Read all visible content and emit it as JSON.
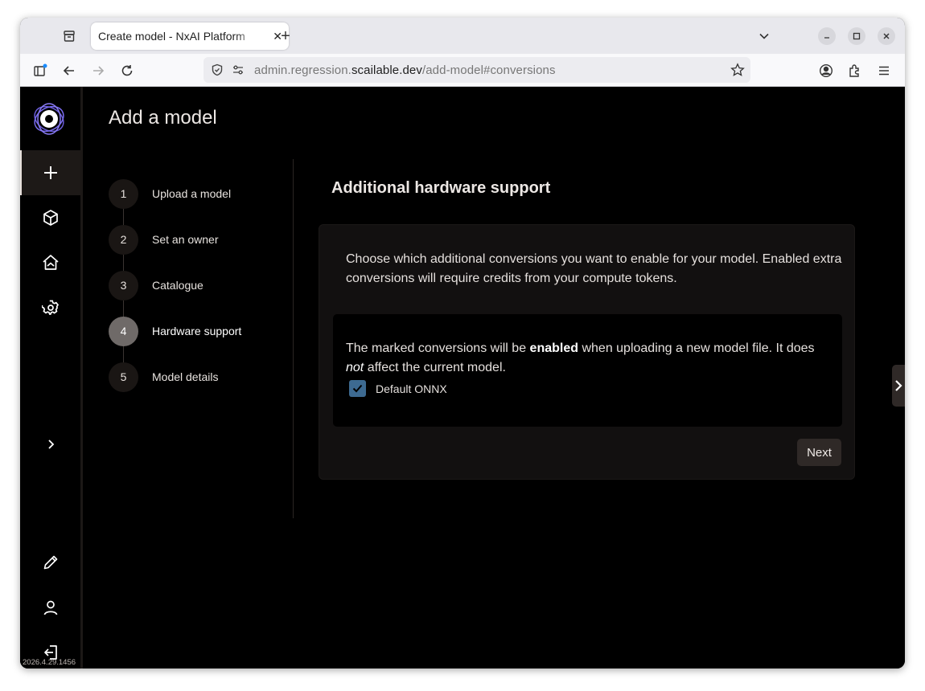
{
  "browser": {
    "tab_title": "Create model - NxAI Platform",
    "tab_close": "✕",
    "new_tab": "+",
    "url_prefix": "admin.regression.",
    "url_domain": "scailable.dev",
    "url_path": "/add-model#conversions"
  },
  "app": {
    "page_title": "Add a model",
    "version": "2026.4.29.1456",
    "sidebar": {
      "items": [
        "add",
        "models",
        "home",
        "settings",
        "expand",
        "edit",
        "account",
        "logout"
      ]
    },
    "steps": [
      {
        "num": "1",
        "label": "Upload a model"
      },
      {
        "num": "2",
        "label": "Set an owner"
      },
      {
        "num": "3",
        "label": "Catalogue"
      },
      {
        "num": "4",
        "label": "Hardware support"
      },
      {
        "num": "5",
        "label": "Model details"
      }
    ],
    "active_step": 4,
    "section_title": "Additional hardware support",
    "description": "Choose which additional conversions you want to enable for your model. Enabled extra conversions will require credits from your compute tokens.",
    "notice": {
      "before": "The marked conversions will be ",
      "bold": "enabled",
      "middle": " when uploading a new model file. It does ",
      "italic": "not",
      "after": " affect the current model."
    },
    "conversion": {
      "label": "Default ONNX",
      "checked": true
    },
    "next_label": "Next"
  },
  "colors": {
    "checkbox": "#3d6a91",
    "logo_ring": "#6a5cd8",
    "button": "#2f2927"
  }
}
